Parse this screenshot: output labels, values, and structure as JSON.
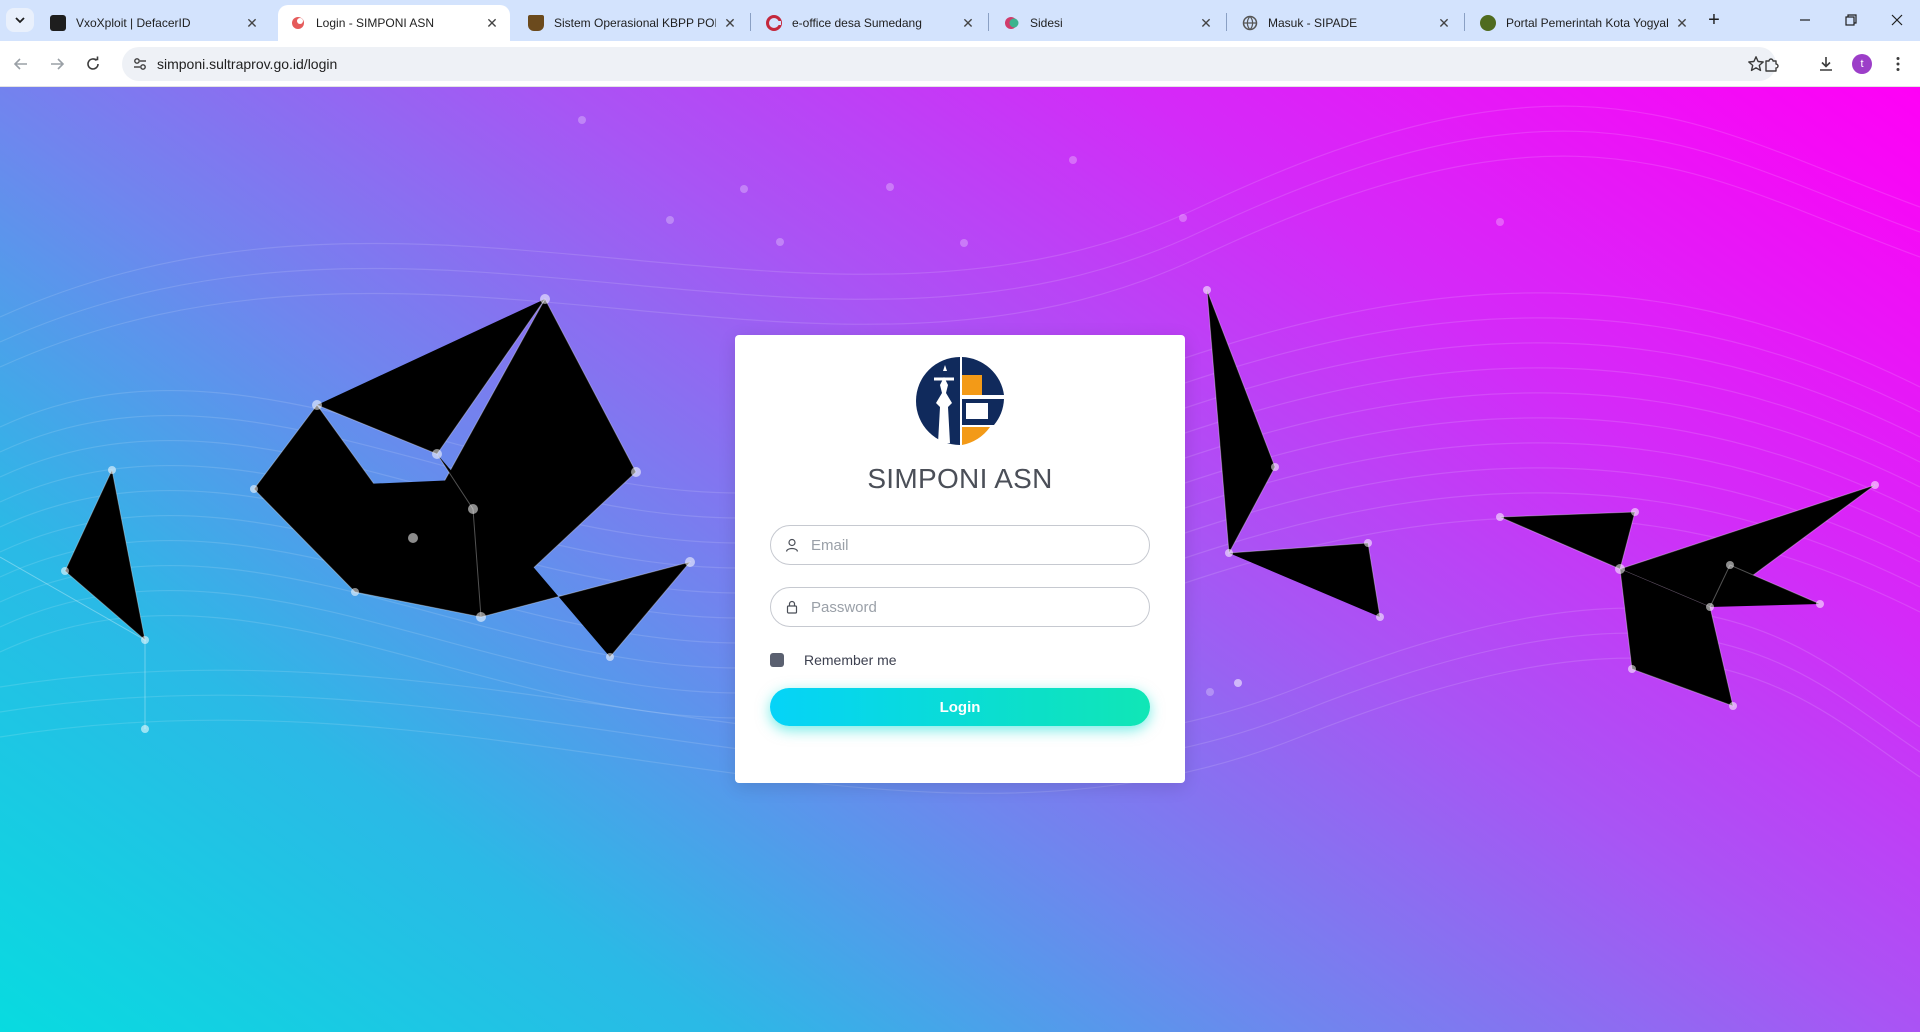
{
  "browser": {
    "tabs": [
      {
        "title": "VxoXploit | DefacerID",
        "favicon_color": "#1e1e1e"
      },
      {
        "title": "Login - SIMPONI ASN",
        "favicon_color": "#e55b5b",
        "active": true
      },
      {
        "title": "Sistem Operasional KBPP POLRI",
        "favicon_color": "#6b4a1d"
      },
      {
        "title": "e-office desa Sumedang",
        "favicon_color": "#c4283c"
      },
      {
        "title": "Sidesi",
        "favicon_color": "#d13b6b"
      },
      {
        "title": "Masuk - SIPADE",
        "favicon_color": "#555555"
      },
      {
        "title": "Portal Pemerintah Kota Yogyakarta",
        "favicon_color": "#4f6b1f"
      }
    ],
    "address": "simponi.sultraprov.go.id/login",
    "profile_initial": "t"
  },
  "login": {
    "title": "SIMPONI ASN",
    "email_placeholder": "Email",
    "password_placeholder": "Password",
    "remember_label": "Remember me",
    "login_label": "Login"
  },
  "colors": {
    "gradient_start": "#08dbe0",
    "gradient_end": "#ff00f6",
    "button_start": "#05d3f8",
    "button_end": "#10e6b6",
    "logo_navy": "#102a5c",
    "logo_orange": "#f39a17"
  }
}
